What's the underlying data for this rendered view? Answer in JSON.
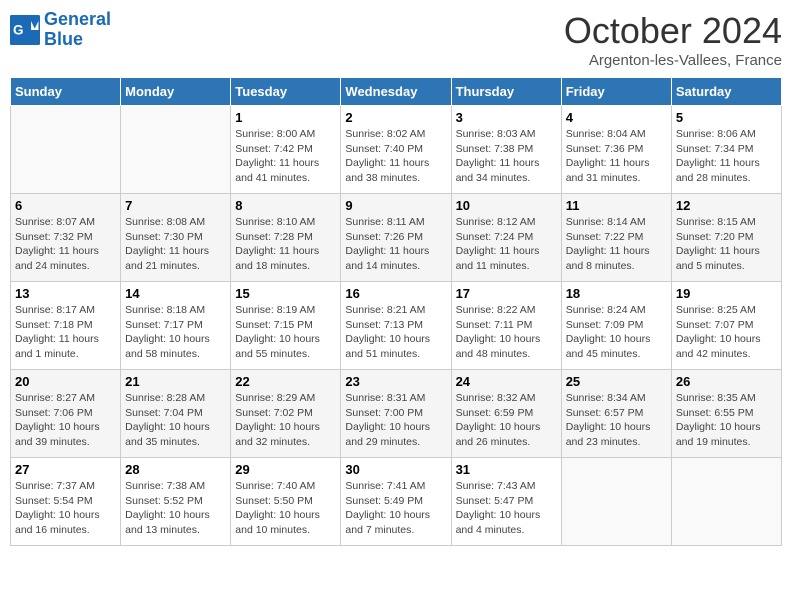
{
  "header": {
    "logo_text_general": "General",
    "logo_text_blue": "Blue",
    "month_title": "October 2024",
    "location": "Argenton-les-Vallees, France"
  },
  "weekdays": [
    "Sunday",
    "Monday",
    "Tuesday",
    "Wednesday",
    "Thursday",
    "Friday",
    "Saturday"
  ],
  "weeks": [
    [
      {
        "day": "",
        "info": ""
      },
      {
        "day": "",
        "info": ""
      },
      {
        "day": "1",
        "info": "Sunrise: 8:00 AM\nSunset: 7:42 PM\nDaylight: 11 hours and 41 minutes."
      },
      {
        "day": "2",
        "info": "Sunrise: 8:02 AM\nSunset: 7:40 PM\nDaylight: 11 hours and 38 minutes."
      },
      {
        "day": "3",
        "info": "Sunrise: 8:03 AM\nSunset: 7:38 PM\nDaylight: 11 hours and 34 minutes."
      },
      {
        "day": "4",
        "info": "Sunrise: 8:04 AM\nSunset: 7:36 PM\nDaylight: 11 hours and 31 minutes."
      },
      {
        "day": "5",
        "info": "Sunrise: 8:06 AM\nSunset: 7:34 PM\nDaylight: 11 hours and 28 minutes."
      }
    ],
    [
      {
        "day": "6",
        "info": "Sunrise: 8:07 AM\nSunset: 7:32 PM\nDaylight: 11 hours and 24 minutes."
      },
      {
        "day": "7",
        "info": "Sunrise: 8:08 AM\nSunset: 7:30 PM\nDaylight: 11 hours and 21 minutes."
      },
      {
        "day": "8",
        "info": "Sunrise: 8:10 AM\nSunset: 7:28 PM\nDaylight: 11 hours and 18 minutes."
      },
      {
        "day": "9",
        "info": "Sunrise: 8:11 AM\nSunset: 7:26 PM\nDaylight: 11 hours and 14 minutes."
      },
      {
        "day": "10",
        "info": "Sunrise: 8:12 AM\nSunset: 7:24 PM\nDaylight: 11 hours and 11 minutes."
      },
      {
        "day": "11",
        "info": "Sunrise: 8:14 AM\nSunset: 7:22 PM\nDaylight: 11 hours and 8 minutes."
      },
      {
        "day": "12",
        "info": "Sunrise: 8:15 AM\nSunset: 7:20 PM\nDaylight: 11 hours and 5 minutes."
      }
    ],
    [
      {
        "day": "13",
        "info": "Sunrise: 8:17 AM\nSunset: 7:18 PM\nDaylight: 11 hours and 1 minute."
      },
      {
        "day": "14",
        "info": "Sunrise: 8:18 AM\nSunset: 7:17 PM\nDaylight: 10 hours and 58 minutes."
      },
      {
        "day": "15",
        "info": "Sunrise: 8:19 AM\nSunset: 7:15 PM\nDaylight: 10 hours and 55 minutes."
      },
      {
        "day": "16",
        "info": "Sunrise: 8:21 AM\nSunset: 7:13 PM\nDaylight: 10 hours and 51 minutes."
      },
      {
        "day": "17",
        "info": "Sunrise: 8:22 AM\nSunset: 7:11 PM\nDaylight: 10 hours and 48 minutes."
      },
      {
        "day": "18",
        "info": "Sunrise: 8:24 AM\nSunset: 7:09 PM\nDaylight: 10 hours and 45 minutes."
      },
      {
        "day": "19",
        "info": "Sunrise: 8:25 AM\nSunset: 7:07 PM\nDaylight: 10 hours and 42 minutes."
      }
    ],
    [
      {
        "day": "20",
        "info": "Sunrise: 8:27 AM\nSunset: 7:06 PM\nDaylight: 10 hours and 39 minutes."
      },
      {
        "day": "21",
        "info": "Sunrise: 8:28 AM\nSunset: 7:04 PM\nDaylight: 10 hours and 35 minutes."
      },
      {
        "day": "22",
        "info": "Sunrise: 8:29 AM\nSunset: 7:02 PM\nDaylight: 10 hours and 32 minutes."
      },
      {
        "day": "23",
        "info": "Sunrise: 8:31 AM\nSunset: 7:00 PM\nDaylight: 10 hours and 29 minutes."
      },
      {
        "day": "24",
        "info": "Sunrise: 8:32 AM\nSunset: 6:59 PM\nDaylight: 10 hours and 26 minutes."
      },
      {
        "day": "25",
        "info": "Sunrise: 8:34 AM\nSunset: 6:57 PM\nDaylight: 10 hours and 23 minutes."
      },
      {
        "day": "26",
        "info": "Sunrise: 8:35 AM\nSunset: 6:55 PM\nDaylight: 10 hours and 19 minutes."
      }
    ],
    [
      {
        "day": "27",
        "info": "Sunrise: 7:37 AM\nSunset: 5:54 PM\nDaylight: 10 hours and 16 minutes."
      },
      {
        "day": "28",
        "info": "Sunrise: 7:38 AM\nSunset: 5:52 PM\nDaylight: 10 hours and 13 minutes."
      },
      {
        "day": "29",
        "info": "Sunrise: 7:40 AM\nSunset: 5:50 PM\nDaylight: 10 hours and 10 minutes."
      },
      {
        "day": "30",
        "info": "Sunrise: 7:41 AM\nSunset: 5:49 PM\nDaylight: 10 hours and 7 minutes."
      },
      {
        "day": "31",
        "info": "Sunrise: 7:43 AM\nSunset: 5:47 PM\nDaylight: 10 hours and 4 minutes."
      },
      {
        "day": "",
        "info": ""
      },
      {
        "day": "",
        "info": ""
      }
    ]
  ]
}
